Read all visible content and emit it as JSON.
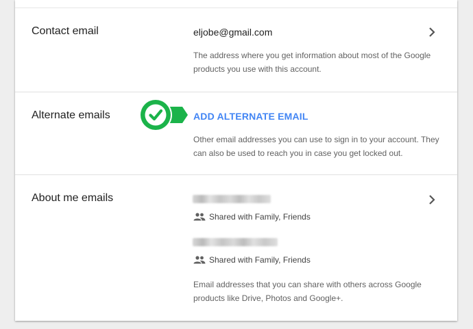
{
  "contact": {
    "label": "Contact email",
    "value": "eljobe@gmail.com",
    "description": "The address where you get information about most of the Google products you use with this account."
  },
  "alternate": {
    "label": "Alternate emails",
    "action": "ADD ALTERNATE EMAIL",
    "description": "Other email addresses you can use to sign in to your account. They can also be used to reach you in case you get locked out."
  },
  "about_me": {
    "label": "About me emails",
    "entries": [
      {
        "sharing": "Shared with Family, Friends"
      },
      {
        "sharing": "Shared with Family, Friends"
      }
    ],
    "description": "Email addresses that you can share with others across Google products like Drive, Photos and Google+."
  },
  "colors": {
    "link": "#4285f4",
    "badge": "#1bb34a"
  },
  "icons": {
    "chevron": "chevron-right-icon",
    "people": "people-icon",
    "badge": "check-circle-icon"
  }
}
